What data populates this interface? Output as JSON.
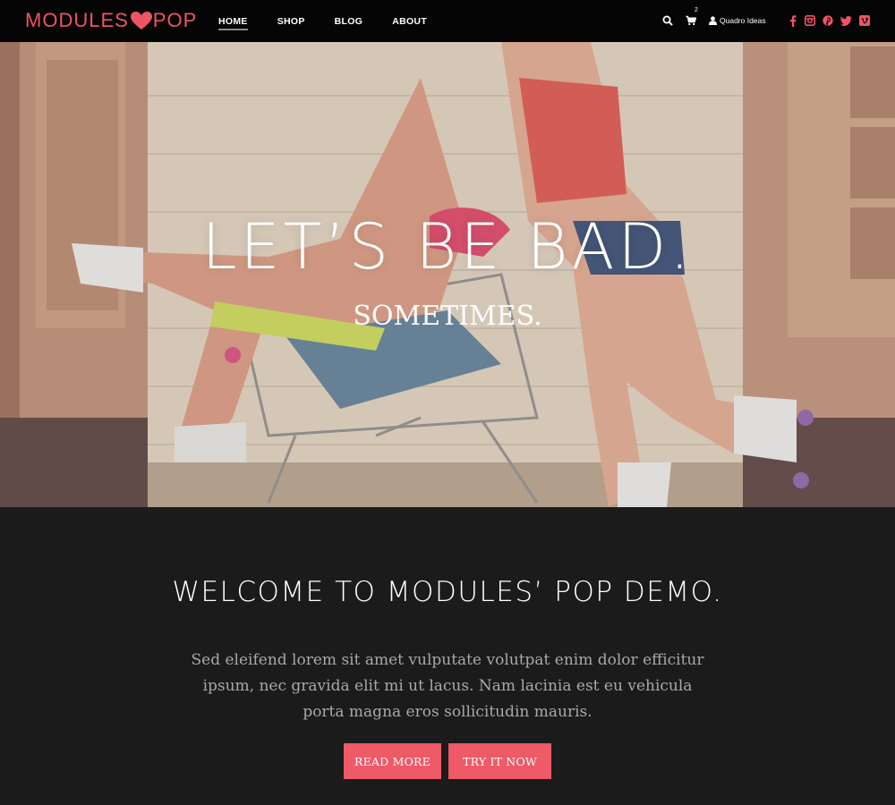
{
  "brand": {
    "name_left": "MODULES",
    "name_right": "POP",
    "accent_color": "#ee5466"
  },
  "nav": {
    "items": [
      {
        "label": "HOME",
        "active": true
      },
      {
        "label": "SHOP",
        "active": false
      },
      {
        "label": "BLOG",
        "active": false
      },
      {
        "label": "ABOUT",
        "active": false
      }
    ],
    "cart_count": "2",
    "account_label": "Quadro Ideas",
    "icons": [
      "search-icon",
      "cart-icon",
      "user-icon",
      "facebook-icon",
      "instagram-icon",
      "pinterest-icon",
      "twitter-icon",
      "vimeo-icon"
    ]
  },
  "hero": {
    "title": "LET’S BE BAD.",
    "subtitle": "SOMETIMES."
  },
  "welcome": {
    "title": "WELCOME TO MODULES’ POP DEMO.",
    "text": "Sed eleifend lorem sit amet vulputate volutpat enim dolor efficitur ipsum, nec gravida elit mi ut lacus. Nam lacinia est eu vehicula porta magna eros sollicitudin mauris.",
    "buttons": {
      "read_more": "READ MORE",
      "try_it": "TRY IT NOW"
    },
    "button_color": "#ee5a66"
  }
}
